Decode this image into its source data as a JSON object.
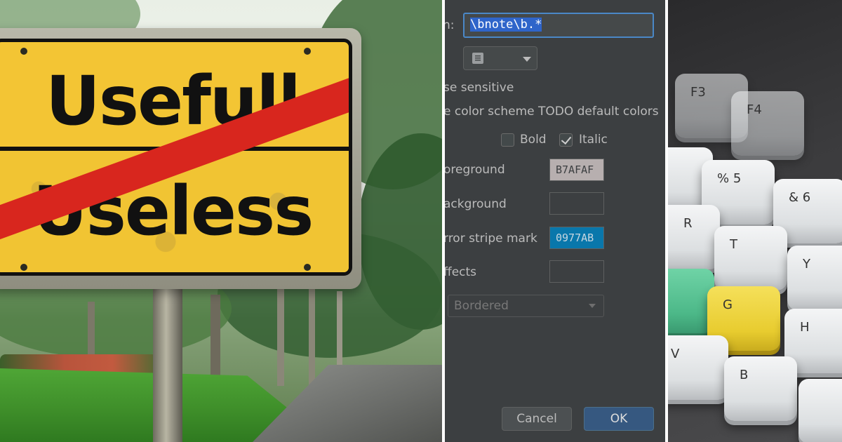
{
  "left_photo": {
    "sign_top_word": "Usefull",
    "sign_bottom_word": "Useless",
    "colors": {
      "sign_yellow": "#f3c534",
      "strike_red": "#d8261e",
      "text": "#111111"
    }
  },
  "dialog": {
    "pattern_label": "n:",
    "pattern_value": "\\bnote\\b.*",
    "icon_dropdown_icon": "document-lines-icon",
    "case_sensitive_label": "se sensitive",
    "scheme_label": "e color scheme TODO default colors",
    "bold_label": "Bold",
    "bold_checked": false,
    "italic_label": "Italic",
    "italic_checked": true,
    "foreground_label": "oreground",
    "foreground_value": "B7AFAF",
    "foreground_color": "#B7AFAF",
    "background_label": "ackground",
    "background_value": "",
    "error_stripe_label": "rror stripe mark",
    "error_stripe_value": "0977AB",
    "error_stripe_color": "#0977AB",
    "effects_label": "ffects",
    "effects_value": "",
    "effect_type": "Bordered",
    "cancel_label": "Cancel",
    "ok_label": "OK",
    "colors": {
      "bg": "#3c3f41",
      "accent": "#4a88c7",
      "ok_button": "#365880"
    }
  },
  "right_photo": {
    "keys": [
      {
        "label": "F3"
      },
      {
        "label": "F4"
      },
      {
        "label": "%\n5"
      },
      {
        "label": "&\n6"
      },
      {
        "label": "R"
      },
      {
        "label": "T"
      },
      {
        "label": "Y"
      },
      {
        "label": "G"
      },
      {
        "label": "H"
      },
      {
        "label": "V"
      },
      {
        "label": "B"
      }
    ]
  }
}
